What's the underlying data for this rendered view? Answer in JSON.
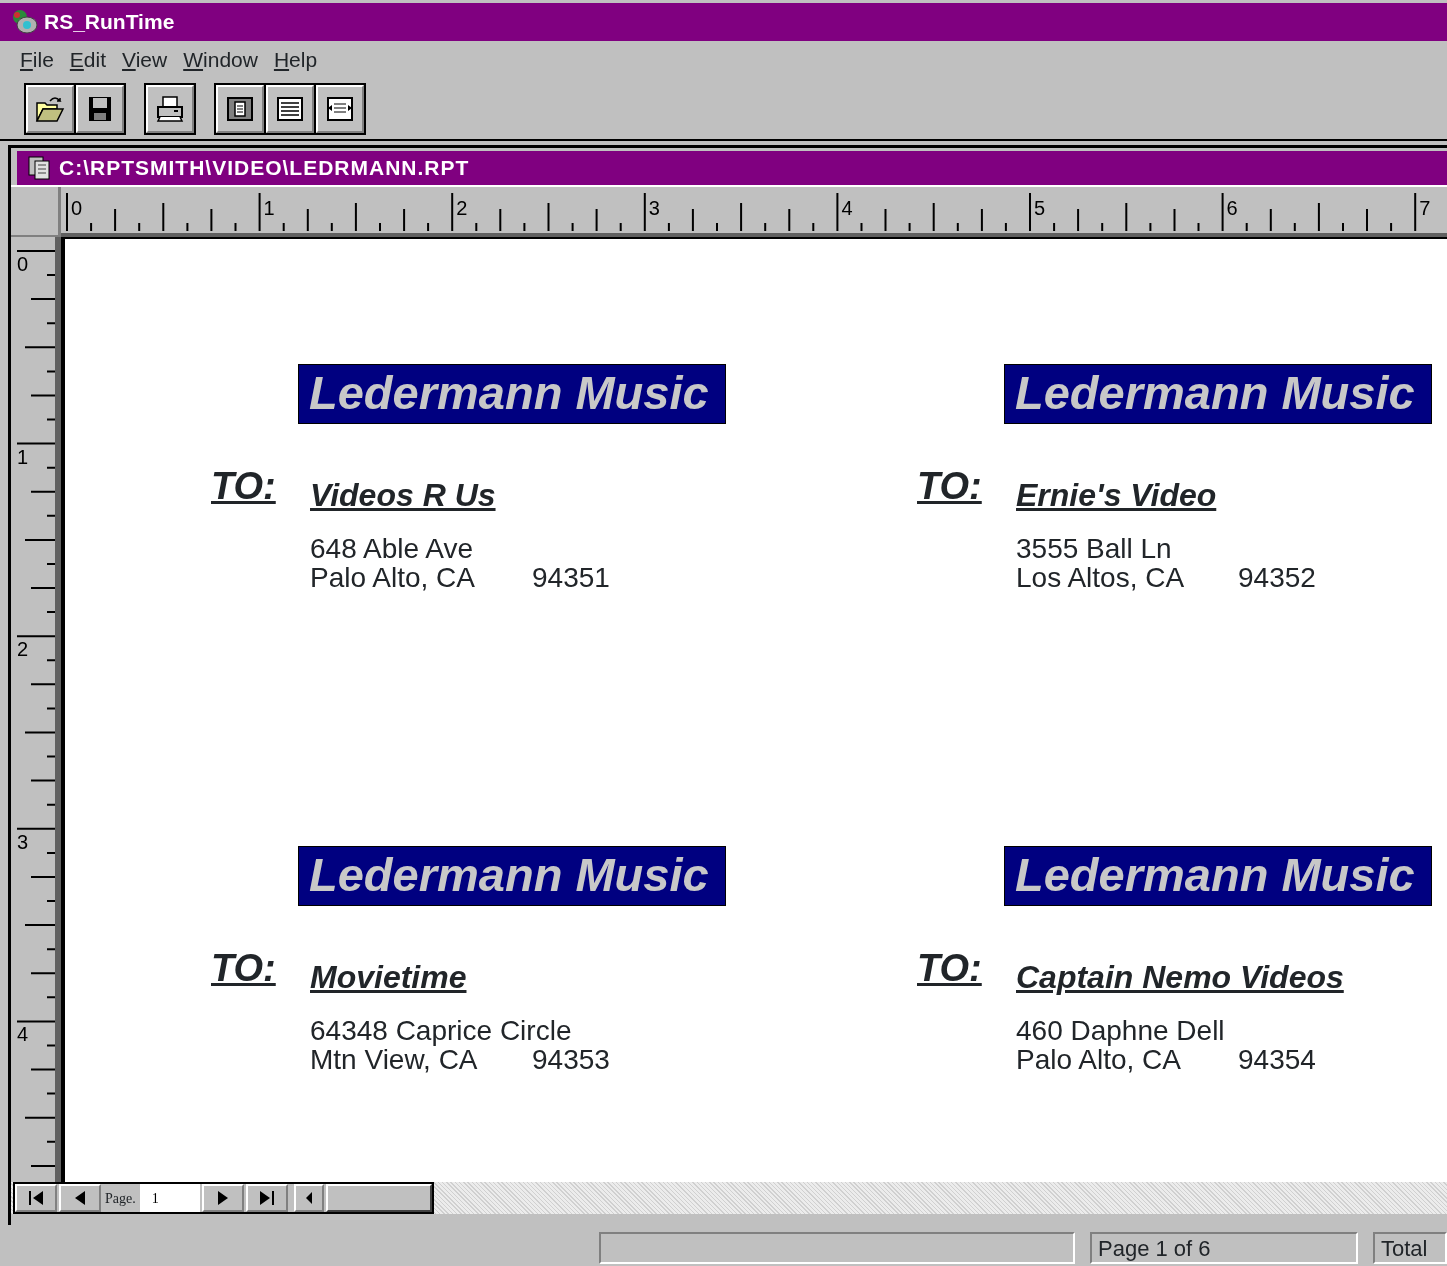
{
  "window": {
    "title": "RS_RunTime"
  },
  "menu": [
    {
      "label": "File"
    },
    {
      "label": "Edit"
    },
    {
      "label": "View"
    },
    {
      "label": "Window"
    },
    {
      "label": "Help"
    }
  ],
  "toolbar": [
    [
      {
        "kind": "open"
      },
      {
        "kind": "save"
      }
    ],
    [
      {
        "kind": "print"
      }
    ],
    [
      {
        "kind": "page"
      },
      {
        "kind": "lines"
      },
      {
        "kind": "fit"
      }
    ]
  ],
  "document": {
    "title": "C:\\RPTSMITH\\VIDEO\\LEDRMANN.RPT"
  },
  "ruler": {
    "horizontal": [
      "0",
      "1",
      "2",
      "3",
      "4",
      "5",
      "6",
      "7"
    ],
    "vertical": [
      "0",
      "1",
      "2",
      "3",
      "4"
    ]
  },
  "labels": [
    {
      "banner": "Ledermann Music",
      "to": "TO:",
      "name": "Videos R Us",
      "street": "648 Able Ave",
      "city": "Palo Alto, CA",
      "zip": "94351"
    },
    {
      "banner": "Ledermann Music",
      "to": "TO:",
      "name": "Ernie's Video",
      "street": "3555 Ball Ln",
      "city": "Los Altos, CA",
      "zip": "94352"
    },
    {
      "banner": "Ledermann Music",
      "to": "TO:",
      "name": "Movietime",
      "street": "64348 Caprice Circle",
      "city": "Mtn View, CA",
      "zip": "94353"
    },
    {
      "banner": "Ledermann Music",
      "to": "TO:",
      "name": "Captain Nemo Videos",
      "street": "460 Daphne Dell",
      "city": "Palo Alto, CA",
      "zip": "94354"
    }
  ],
  "navigator": {
    "page_label": "Page.",
    "page_value": "1"
  },
  "status_bar": {
    "page": "Page 1 of 6",
    "total": "Total"
  }
}
